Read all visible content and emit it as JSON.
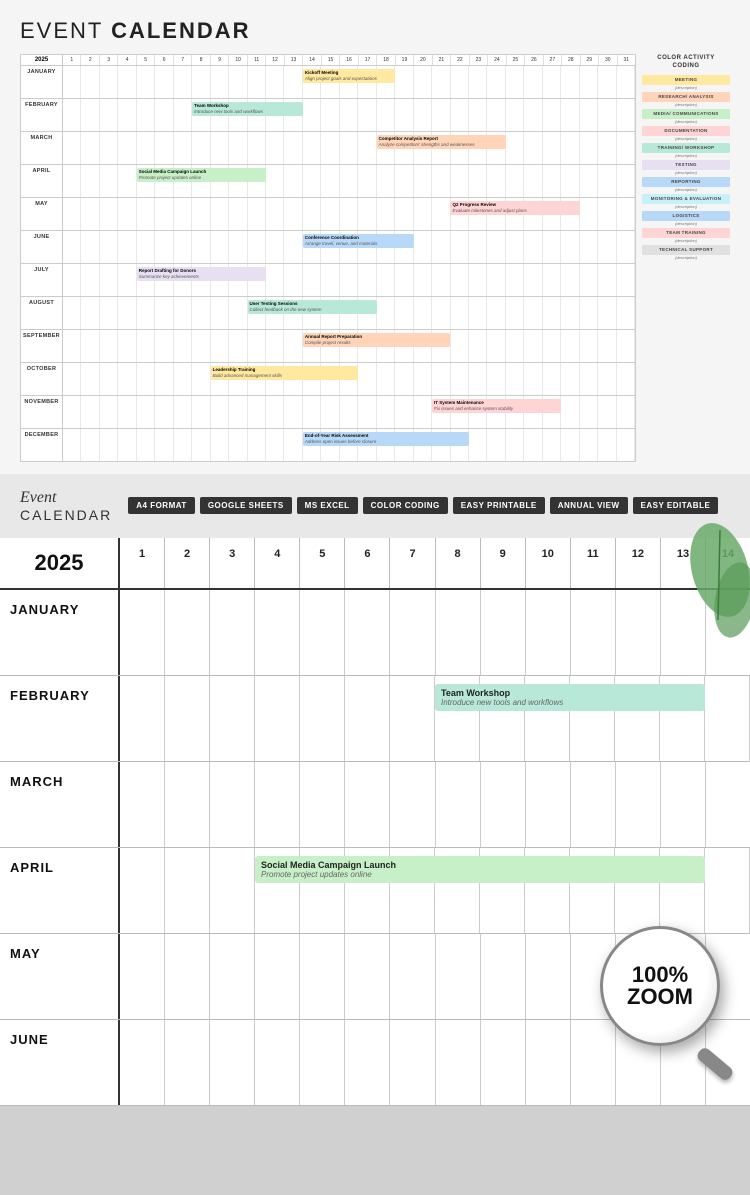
{
  "page": {
    "title": "EVENT CALENDAR"
  },
  "top_calendar": {
    "year": "2025",
    "days": [
      "1",
      "2",
      "3",
      "4",
      "5",
      "6",
      "7",
      "8",
      "9",
      "10",
      "11",
      "12",
      "13",
      "14",
      "15",
      "16",
      "17",
      "18",
      "19",
      "20",
      "21",
      "22",
      "23",
      "24",
      "25",
      "26",
      "27",
      "28",
      "29",
      "30",
      "31"
    ],
    "months": [
      {
        "label": "JANUARY"
      },
      {
        "label": "FEBRUARY"
      },
      {
        "label": "MARCH"
      },
      {
        "label": "APRIL"
      },
      {
        "label": "MAY"
      },
      {
        "label": "JUNE"
      },
      {
        "label": "JULY"
      },
      {
        "label": "AUGUST"
      },
      {
        "label": "SEPTEMBER"
      },
      {
        "label": "OCTOBER"
      },
      {
        "label": "NOVEMBER"
      },
      {
        "label": "DECEMBER"
      }
    ],
    "events": [
      {
        "month": 0,
        "title": "Kickoff Meeting",
        "desc": "Align project goals and expectations",
        "color": "#ffe8a0",
        "startDay": 14,
        "spanDays": 5
      },
      {
        "month": 1,
        "title": "Team Workshop",
        "desc": "Introduce new tools and workflows",
        "color": "#b8e8d8",
        "startDay": 8,
        "spanDays": 6
      },
      {
        "month": 2,
        "title": "Competitor Analysis Report",
        "desc": "Analyze competitors' strengths and weaknesses",
        "color": "#ffd4b8",
        "startDay": 18,
        "spanDays": 7
      },
      {
        "month": 3,
        "title": "Social Media Campaign Launch",
        "desc": "Promote project updates online",
        "color": "#c8f0c8",
        "startDay": 5,
        "spanDays": 7
      },
      {
        "month": 4,
        "title": "Q2 Progress Review",
        "desc": "Evaluate milestones and adjust plans",
        "color": "#ffd4d4",
        "startDay": 22,
        "spanDays": 7
      },
      {
        "month": 5,
        "title": "Conference Coordination",
        "desc": "Arrange travel, venue, and materials",
        "color": "#b8d8f8",
        "startDay": 14,
        "spanDays": 6
      },
      {
        "month": 6,
        "title": "Report Drafting for Donors",
        "desc": "Summarize key achievements",
        "color": "#e8e0f0",
        "startDay": 5,
        "spanDays": 7
      },
      {
        "month": 7,
        "title": "User Testing Sessions",
        "desc": "Collect feedback on the new system",
        "color": "#b8e8d8",
        "startDay": 11,
        "spanDays": 7
      },
      {
        "month": 8,
        "title": "Annual Report Preparation",
        "desc": "Compile project results",
        "color": "#ffd4b8",
        "startDay": 14,
        "spanDays": 8
      },
      {
        "month": 9,
        "title": "Leadership Training",
        "desc": "Build advanced management skills",
        "color": "#ffe8a0",
        "startDay": 9,
        "spanDays": 8
      },
      {
        "month": 10,
        "title": "IT System Maintenance",
        "desc": "Fix issues and enhance system stability",
        "color": "#ffd4d4",
        "startDay": 21,
        "spanDays": 7
      },
      {
        "month": 11,
        "title": "End-of-Year Risk Assessment",
        "desc": "Address open issues before closure",
        "color": "#b8d8f8",
        "startDay": 14,
        "spanDays": 9
      }
    ]
  },
  "legend": {
    "title": "COLOR ACTIVITY\nCODING",
    "items": [
      {
        "label": "MEETING",
        "color": "#ffe8a0",
        "desc": "(description)"
      },
      {
        "label": "RESEARCH/ ANALYSIS",
        "color": "#ffd4b8",
        "desc": "(description)"
      },
      {
        "label": "MEDIA/ COMMUNICATIONS",
        "color": "#c8f0c8",
        "desc": "(description)"
      },
      {
        "label": "DOCUMENTATION",
        "color": "#ffd4d4",
        "desc": "(description)"
      },
      {
        "label": "TRAINING/ WORKSHOP",
        "color": "#b8e8d8",
        "desc": "(description)"
      },
      {
        "label": "TESTING",
        "color": "#e8e0f0",
        "desc": "(description)"
      },
      {
        "label": "REPORTING",
        "color": "#b8d8f8",
        "desc": "(description)"
      },
      {
        "label": "MONITORING & EVALUATION",
        "color": "#c8f0f8",
        "desc": "(description)"
      },
      {
        "label": "LOGISTICS",
        "color": "#b8d8f8",
        "desc": "(description)"
      },
      {
        "label": "TEAM TRAINING",
        "color": "#ffd4d4",
        "desc": "(description)"
      },
      {
        "label": "TECHNICAL SUPPORT",
        "color": "#e0e0e0",
        "desc": "(description)"
      }
    ]
  },
  "middle": {
    "brand_event": "Event",
    "brand_calendar": "CALENDAR",
    "tags": [
      "A4 FORMAT",
      "GOOGLE SHEETS",
      "MS EXCEL",
      "COLOR CODING",
      "EASY PRINTABLE",
      "ANNUAL VIEW",
      "EASY EDITABLE"
    ]
  },
  "bottom_calendar": {
    "year": "2025",
    "days": [
      "1",
      "2",
      "3",
      "4",
      "5",
      "6",
      "7",
      "8",
      "9",
      "10",
      "11",
      "12",
      "13",
      "14"
    ],
    "months": [
      {
        "label": "JANUARY"
      },
      {
        "label": "FEBRUARY"
      },
      {
        "label": "MARCH"
      },
      {
        "label": "APRIL"
      },
      {
        "label": "MAY"
      },
      {
        "label": "JUNE"
      }
    ],
    "events": [
      {
        "month": 1,
        "title": "Team Workshop",
        "desc": "Introduce new tools and workflows",
        "color": "#b8e8d8",
        "startCol": 8,
        "spanCols": 6
      },
      {
        "month": 3,
        "title": "Social Media Campaign Launch",
        "desc": "Promote project updates online",
        "color": "#c8f0c8",
        "startCol": 4,
        "spanCols": 10
      }
    ]
  },
  "zoom": {
    "text": "100%\nZOOM"
  }
}
